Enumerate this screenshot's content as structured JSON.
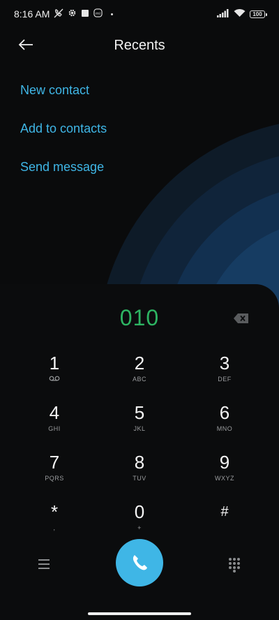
{
  "status_bar": {
    "time": "8:16 AM",
    "battery": "100",
    "icons": [
      "mute-call-icon",
      "gear-icon",
      "square-icon",
      "mi-icon",
      "signal-icon",
      "wifi-icon"
    ]
  },
  "header": {
    "title": "Recents",
    "back_icon": "back-arrow-icon"
  },
  "actions": [
    {
      "label": "New contact"
    },
    {
      "label": "Add to contacts"
    },
    {
      "label": "Send message"
    }
  ],
  "dialer": {
    "number": "010",
    "number_color": "#2db462",
    "backspace_icon": "backspace-icon",
    "keys": [
      {
        "digit": "1",
        "letters": ""
      },
      {
        "digit": "2",
        "letters": "ABC"
      },
      {
        "digit": "3",
        "letters": "DEF"
      },
      {
        "digit": "4",
        "letters": "GHI"
      },
      {
        "digit": "5",
        "letters": "JKL"
      },
      {
        "digit": "6",
        "letters": "MNO"
      },
      {
        "digit": "7",
        "letters": "PQRS"
      },
      {
        "digit": "8",
        "letters": "TUV"
      },
      {
        "digit": "9",
        "letters": "WXYZ"
      },
      {
        "digit": "*",
        "letters": ","
      },
      {
        "digit": "0",
        "letters": "+"
      },
      {
        "digit": "#",
        "letters": ""
      }
    ],
    "voicemail_icon": "voicemail-icon",
    "menu_icon": "menu-icon",
    "call_icon": "phone-icon",
    "keypad_icon": "dialpad-icon",
    "accent_color": "#3fb6e6"
  }
}
